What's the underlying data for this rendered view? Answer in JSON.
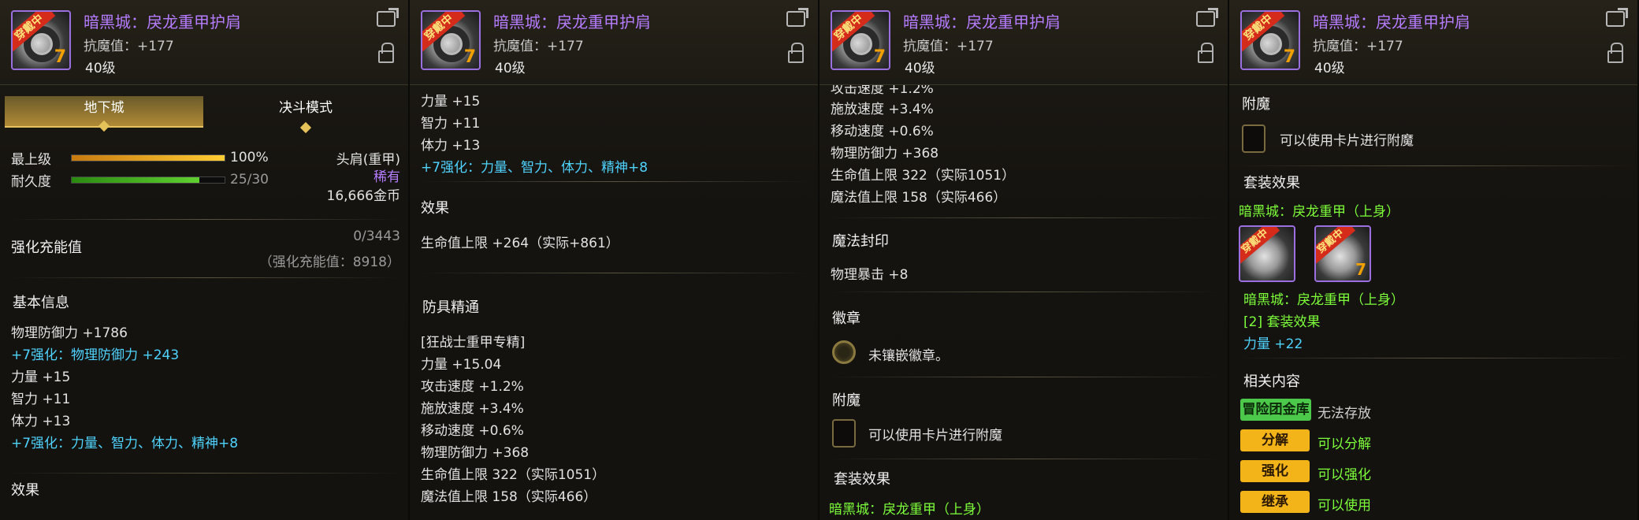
{
  "item": {
    "name": "暗黑城：戾龙重甲护肩",
    "stat": "抗魔值：+177",
    "level": "40级",
    "badge": "穿戴中",
    "grade_num": "7"
  },
  "panel1": {
    "tabs": [
      "地下城",
      "决斗模式"
    ],
    "grade_label": "最上级",
    "grade_value": "100%",
    "grade_fill": 1.0,
    "durability_label": "耐久度",
    "durability_value": "25/30",
    "durability_fill": 0.833,
    "slot_type": "头肩(重甲)",
    "rarity": "稀有",
    "price": "16,666金币",
    "charge_title": "强化充能值",
    "charge_value": "0/3443",
    "charge_sub": "（强化充能值：8918）",
    "basic_title": "基本信息",
    "lines": [
      {
        "text": "物理防御力 +1786",
        "cls": ""
      },
      {
        "text": "+7强化：物理防御力 +243",
        "cls": "cy"
      },
      {
        "text": "力量 +15",
        "cls": ""
      },
      {
        "text": "智力 +11",
        "cls": ""
      },
      {
        "text": "体力 +13",
        "cls": ""
      },
      {
        "text": "+7强化：力量、智力、体力、精神+8",
        "cls": "cy"
      }
    ],
    "effect_title": "效果"
  },
  "panel2": {
    "top_lines": [
      {
        "text": "力量 +15",
        "cls": ""
      },
      {
        "text": "智力 +11",
        "cls": ""
      },
      {
        "text": "体力 +13",
        "cls": ""
      },
      {
        "text": "+7强化：力量、智力、体力、精神+8",
        "cls": "cy"
      }
    ],
    "effect_title": "效果",
    "effect_line": "生命值上限 +264（实际+861）",
    "mastery_title": "防具精通",
    "mastery_lines": [
      "[狂战士重甲专精]",
      "力量 +15.04",
      "攻击速度 +1.2%",
      "施放速度 +3.4%",
      "移动速度 +0.6%",
      "物理防御力 +368",
      "生命值上限 322（实际1051）",
      "魔法值上限 158（实际466）"
    ]
  },
  "panel3": {
    "cut_line": "攻击速度 +1.2%",
    "top_lines": [
      "施放速度 +3.4%",
      "移动速度 +0.6%",
      "物理防御力 +368",
      "生命值上限 322（实际1051）",
      "魔法值上限 158（实际466）"
    ],
    "seal_title": "魔法封印",
    "seal_line": "物理暴击 +8",
    "emblem_title": "徽章",
    "emblem_line": "未镶嵌徽章。",
    "enchant_title": "附魔",
    "enchant_line": "可以使用卡片进行附魔",
    "set_title": "套装效果",
    "set_cut": "暗黑城：戾龙重甲（上身）"
  },
  "panel4": {
    "enchant_title": "附魔",
    "enchant_line": "可以使用卡片进行附魔",
    "set_title": "套装效果",
    "set_name": "暗黑城：戾龙重甲（上身）",
    "set_item": "暗黑城：戾龙重甲（上身）",
    "set_bonus": "[2] 套装效果",
    "set_stat": "力量 +22",
    "related_title": "相关内容",
    "rows": [
      {
        "btn": "冒险团金库",
        "color": "green",
        "text": "无法存放",
        "tcls": "gd"
      },
      {
        "btn": "分解",
        "color": "yellow",
        "text": "可以分解",
        "tcls": "gr"
      },
      {
        "btn": "强化",
        "color": "yellow",
        "text": "可以强化",
        "tcls": "gr"
      },
      {
        "btn": "继承",
        "color": "yellow",
        "text": "可以使用",
        "tcls": "gr"
      }
    ]
  }
}
